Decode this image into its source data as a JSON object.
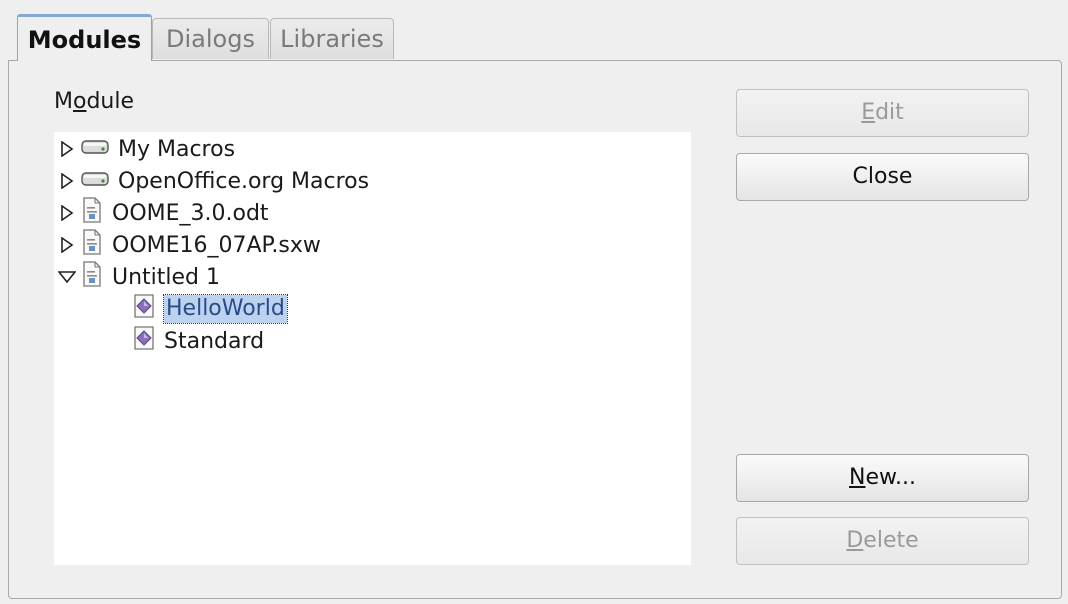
{
  "tabs": [
    {
      "label": "Modules",
      "active": true
    },
    {
      "label": "Dialogs",
      "active": false
    },
    {
      "label": "Libraries",
      "active": false
    }
  ],
  "module_label": "Module",
  "tree": [
    {
      "label": "My Macros",
      "icon": "drive-icon",
      "expander": "collapsed",
      "depth": 0
    },
    {
      "label": "OpenOffice.org Macros",
      "icon": "drive-icon",
      "expander": "collapsed",
      "depth": 0
    },
    {
      "label": "OOME_3.0.odt",
      "icon": "document-icon",
      "expander": "collapsed",
      "depth": 0
    },
    {
      "label": "OOME16_07AP.sxw",
      "icon": "document-icon",
      "expander": "collapsed",
      "depth": 0
    },
    {
      "label": "Untitled 1",
      "icon": "document-icon",
      "expander": "expanded",
      "depth": 0
    },
    {
      "label": "HelloWorld",
      "icon": "module-icon",
      "expander": "none",
      "depth": 1,
      "selected": true
    },
    {
      "label": "Standard",
      "icon": "module-icon",
      "expander": "none",
      "depth": 1
    }
  ],
  "buttons": {
    "edit": "Edit",
    "close": "Close",
    "new": "New...",
    "delete": "Delete"
  },
  "colors": {
    "selection": "#bcd2ee",
    "active_tab_accent": "#86a8d6"
  }
}
